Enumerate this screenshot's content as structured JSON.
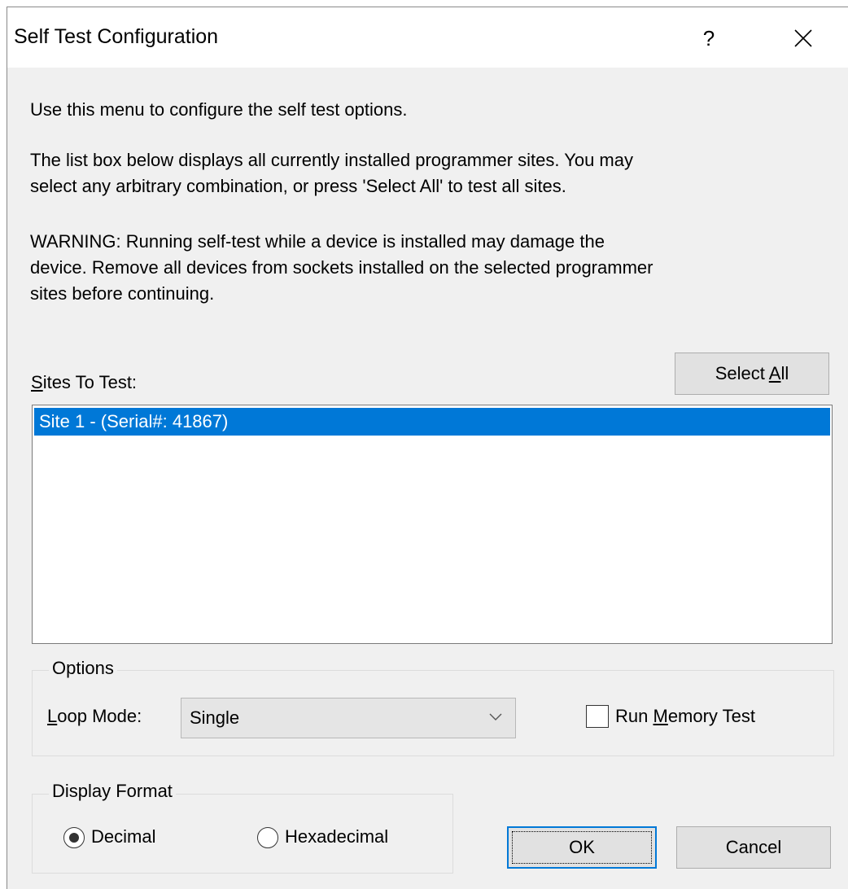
{
  "window": {
    "title": "Self Test Configuration",
    "help_label": "?",
    "close_label": "✕"
  },
  "body": {
    "intro": "Use this menu to configure the self test options.",
    "paragraph2": "The list box below displays all currently installed programmer sites.  You may\nselect any arbitrary combination, or press 'Select All' to test all sites.",
    "warning": "WARNING: Running self-test while a device is installed may damage the\ndevice.  Remove all devices from sockets installed on the selected programmer\nsites before continuing."
  },
  "sites": {
    "label_mnemonic": "S",
    "label_rest": "ites To Test:",
    "select_all_pre": "Select ",
    "select_all_mnemonic": "A",
    "select_all_post": "ll",
    "items": [
      "Site 1 - (Serial#: 41867)"
    ],
    "selected_index": 0
  },
  "options": {
    "legend": "Options",
    "loop_mode_mnemonic": "L",
    "loop_mode_rest": "oop Mode:",
    "loop_mode_value": "Single",
    "memory_test_pre": "Run ",
    "memory_test_mnemonic": "M",
    "memory_test_post": "emory Test",
    "memory_test_checked": false
  },
  "display_format": {
    "legend": "Display Format",
    "decimal_label": "Decimal",
    "hex_label": "Hexadecimal",
    "selected": "Decimal"
  },
  "actions": {
    "ok_label": "OK",
    "cancel_label": "Cancel"
  },
  "colors": {
    "selection": "#0078d7",
    "dialog_bg": "#f0f0f0",
    "button_bg": "#e1e1e1"
  }
}
